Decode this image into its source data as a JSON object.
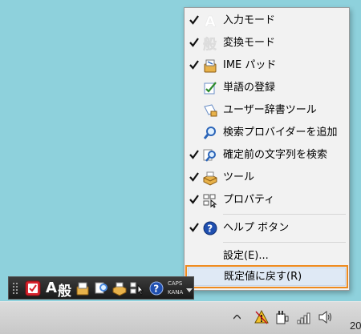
{
  "menu": {
    "items": [
      {
        "label": "入力モード",
        "checked": true,
        "icon": "input-mode-a-icon"
      },
      {
        "label": "変換モード",
        "checked": true,
        "icon": "conversion-mode-icon"
      },
      {
        "label": "IME パッド",
        "checked": true,
        "icon": "ime-pad-icon"
      },
      {
        "label": "単語の登録",
        "checked": false,
        "icon": "word-register-icon"
      },
      {
        "label": "ユーザー辞書ツール",
        "checked": false,
        "icon": "user-dictionary-icon"
      },
      {
        "label": "検索プロバイダーを追加",
        "checked": false,
        "icon": "search-provider-icon"
      },
      {
        "label": "確定前の文字列を検索",
        "checked": true,
        "icon": "search-string-icon"
      },
      {
        "label": "ツール",
        "checked": true,
        "icon": "tool-icon"
      },
      {
        "label": "プロパティ",
        "checked": true,
        "icon": "properties-icon"
      },
      {
        "label": "ヘルプ ボタン",
        "checked": true,
        "icon": "help-icon"
      },
      {
        "label": "設定(E)...",
        "checked": false,
        "icon": ""
      },
      {
        "label": "既定値に戻す(R)",
        "checked": false,
        "icon": ""
      }
    ]
  },
  "langbar": {
    "mode_char": "A",
    "conversion_char": "般",
    "caps": "CAPS",
    "kana": "KANA"
  },
  "taskbar": {
    "clock_partial": "20"
  },
  "colors": {
    "desktop": "#8ed1dc",
    "highlight_border": "#ef8a1d",
    "menu_bg": "#f2f2f2"
  }
}
